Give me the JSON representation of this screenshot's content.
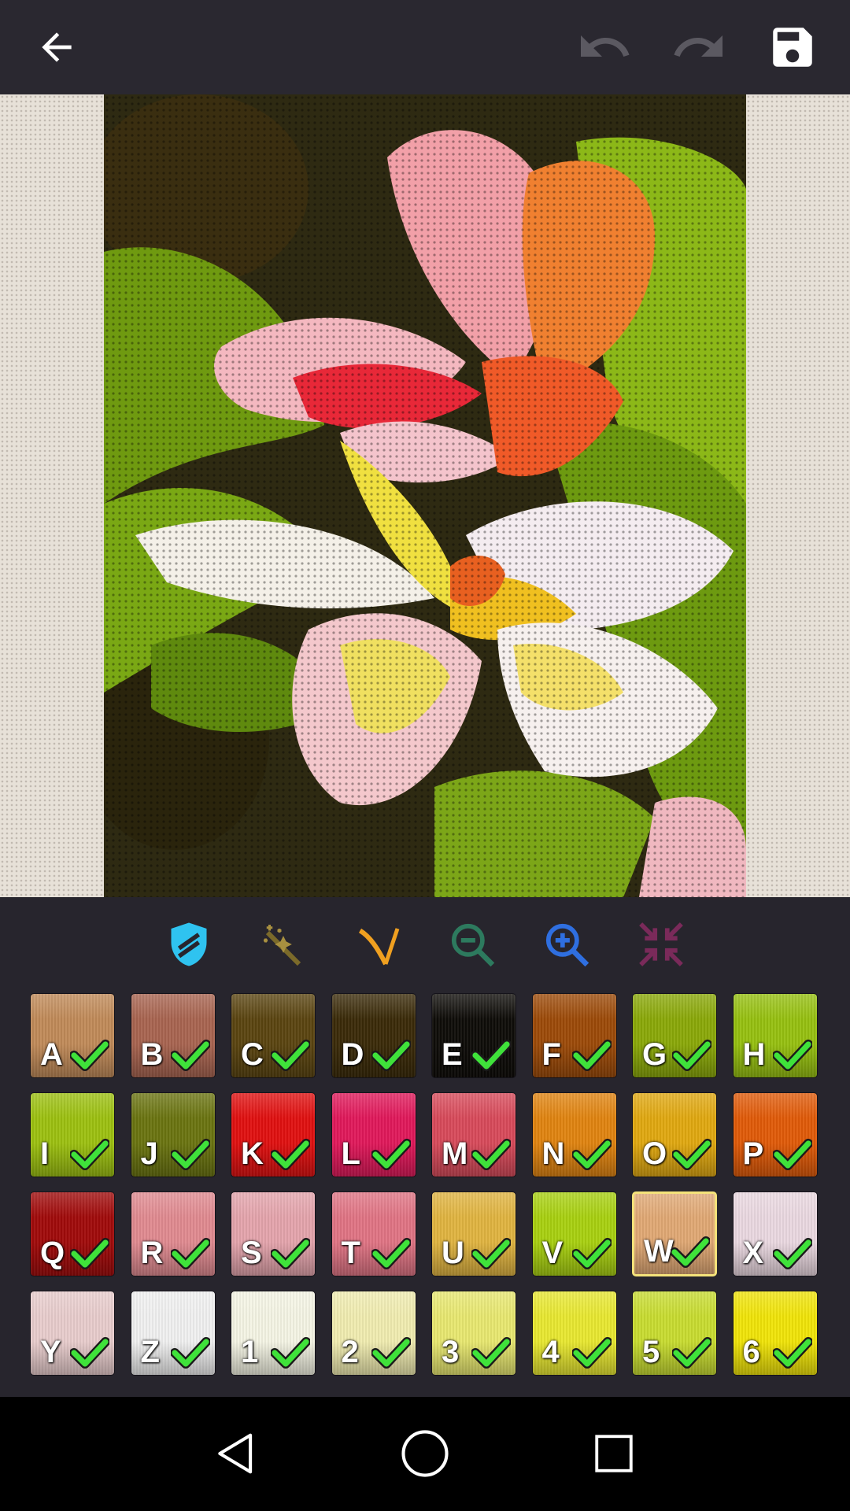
{
  "toolbar": {
    "back_icon": "arrow-left-icon",
    "undo_icon": "undo-icon",
    "redo_icon": "redo-icon",
    "save_icon": "floppy-disk-icon"
  },
  "tools": [
    {
      "name": "shield-tool-icon",
      "color": "#2fc3f0",
      "active": true
    },
    {
      "name": "magic-wand-icon",
      "color": "#7b6a2a"
    },
    {
      "name": "needle-icon",
      "color": "#f0a020"
    },
    {
      "name": "zoom-out-icon",
      "color": "#2d7a5e"
    },
    {
      "name": "zoom-in-icon",
      "color": "#2f6fe0"
    },
    {
      "name": "collapse-icon",
      "color": "#7a2a5a"
    }
  ],
  "palette": [
    {
      "label": "A",
      "color": "#c08a58"
    },
    {
      "label": "B",
      "color": "#a86450"
    },
    {
      "label": "C",
      "color": "#5a4410"
    },
    {
      "label": "D",
      "color": "#3a2a08"
    },
    {
      "label": "E",
      "color": "#0e0c08"
    },
    {
      "label": "F",
      "color": "#9c4a08"
    },
    {
      "label": "G",
      "color": "#8aa808"
    },
    {
      "label": "H",
      "color": "#96c010"
    },
    {
      "label": "I",
      "color": "#9cc010"
    },
    {
      "label": "J",
      "color": "#6a7410"
    },
    {
      "label": "K",
      "color": "#e01010"
    },
    {
      "label": "L",
      "color": "#e0185a"
    },
    {
      "label": "M",
      "color": "#d84a5a"
    },
    {
      "label": "N",
      "color": "#e08410"
    },
    {
      "label": "O",
      "color": "#e0a810"
    },
    {
      "label": "P",
      "color": "#e05a08"
    },
    {
      "label": "Q",
      "color": "#a00a0a"
    },
    {
      "label": "R",
      "color": "#e08a90"
    },
    {
      "label": "S",
      "color": "#e4a4ac"
    },
    {
      "label": "T",
      "color": "#e07484"
    },
    {
      "label": "U",
      "color": "#e0b440"
    },
    {
      "label": "V",
      "color": "#a8d010"
    },
    {
      "label": "W",
      "color": "#e0a874",
      "selected": true
    },
    {
      "label": "X",
      "color": "#ead8e0"
    },
    {
      "label": "Y",
      "color": "#e8cccc"
    },
    {
      "label": "Z",
      "color": "#f0f0f0"
    },
    {
      "label": "1",
      "color": "#f4f4e4"
    },
    {
      "label": "2",
      "color": "#f0ecb0"
    },
    {
      "label": "3",
      "color": "#e8e870"
    },
    {
      "label": "4",
      "color": "#e8e830"
    },
    {
      "label": "5",
      "color": "#c8dc30"
    },
    {
      "label": "6",
      "color": "#f0e408"
    }
  ],
  "navbar": {
    "back_icon": "nav-back-icon",
    "home_icon": "nav-home-icon",
    "recents_icon": "nav-recents-icon"
  }
}
